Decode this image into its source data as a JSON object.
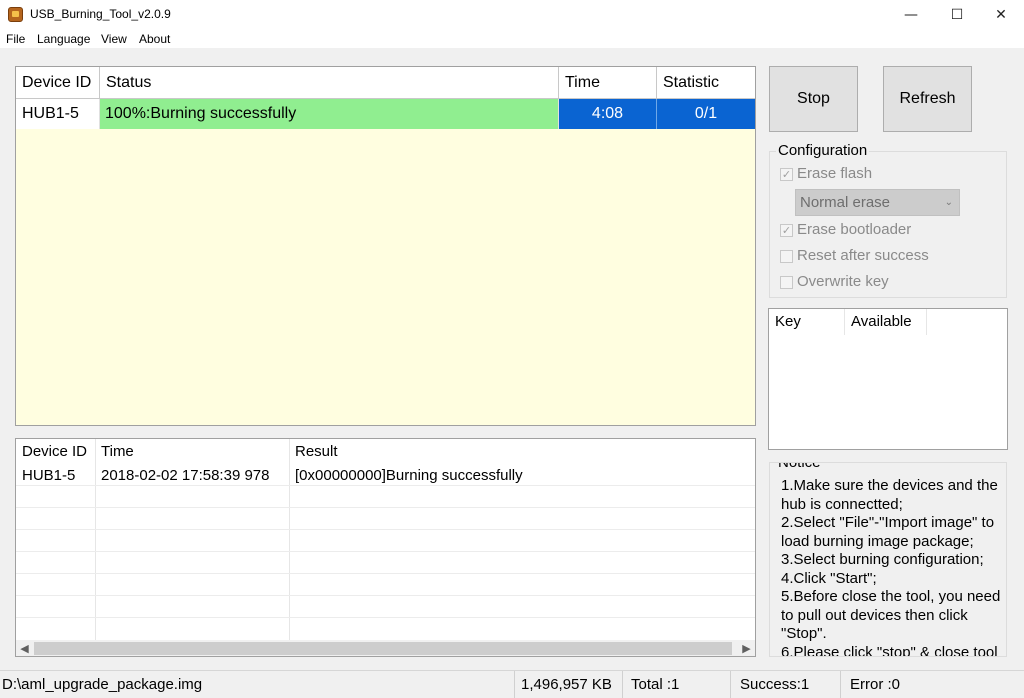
{
  "window": {
    "title": "USB_Burning_Tool_v2.0.9",
    "minimize": "—",
    "maximize": "☐",
    "close": "✕"
  },
  "menu": [
    "File",
    "Language",
    "View",
    "About"
  ],
  "device_table": {
    "columns": [
      "Device ID",
      "Status",
      "Time",
      "Statistic"
    ],
    "rows": [
      {
        "device_id": "HUB1-5",
        "status": "100%:Burning successfully",
        "time": "4:08",
        "statistic": "0/1"
      }
    ]
  },
  "log_table": {
    "columns": [
      "Device ID",
      "Time",
      "Result"
    ],
    "rows": [
      {
        "device_id": "HUB1-5",
        "time": "2018-02-02 17:58:39 978",
        "result": "[0x00000000]Burning successfully"
      }
    ]
  },
  "buttons": {
    "stop": "Stop",
    "refresh": "Refresh"
  },
  "configuration": {
    "title": "Configuration",
    "erase_flash": {
      "label": "Erase flash",
      "checked": true
    },
    "erase_mode": "Normal erase",
    "erase_bootloader": {
      "label": "Erase bootloader",
      "checked": true
    },
    "reset_after_success": {
      "label": "Reset after success",
      "checked": false
    },
    "overwrite_key": {
      "label": "Overwrite key",
      "checked": false
    }
  },
  "key_table": {
    "columns": [
      "Key",
      "Available"
    ]
  },
  "notice": {
    "title": "Notice",
    "lines": [
      "1.Make sure the devices and the hub is connectted;",
      "2.Select \"File\"-\"Import image\" to load burning image package;",
      "3.Select burning configuration;",
      "4.Click \"Start\";",
      "5.Before close the tool, you need to pull out devices then click \"Stop\".",
      "6.Please click \"stop\" & close tool"
    ]
  },
  "status_bar": {
    "file_path": "D:\\aml_upgrade_package.img",
    "size": "1,496,957 KB",
    "total": "Total :1",
    "success": "Success:1",
    "error": "Error :0"
  },
  "colors": {
    "status_success": "#90ee90",
    "cell_selected": "#0a64d2",
    "table_bg": "#fffee0"
  }
}
